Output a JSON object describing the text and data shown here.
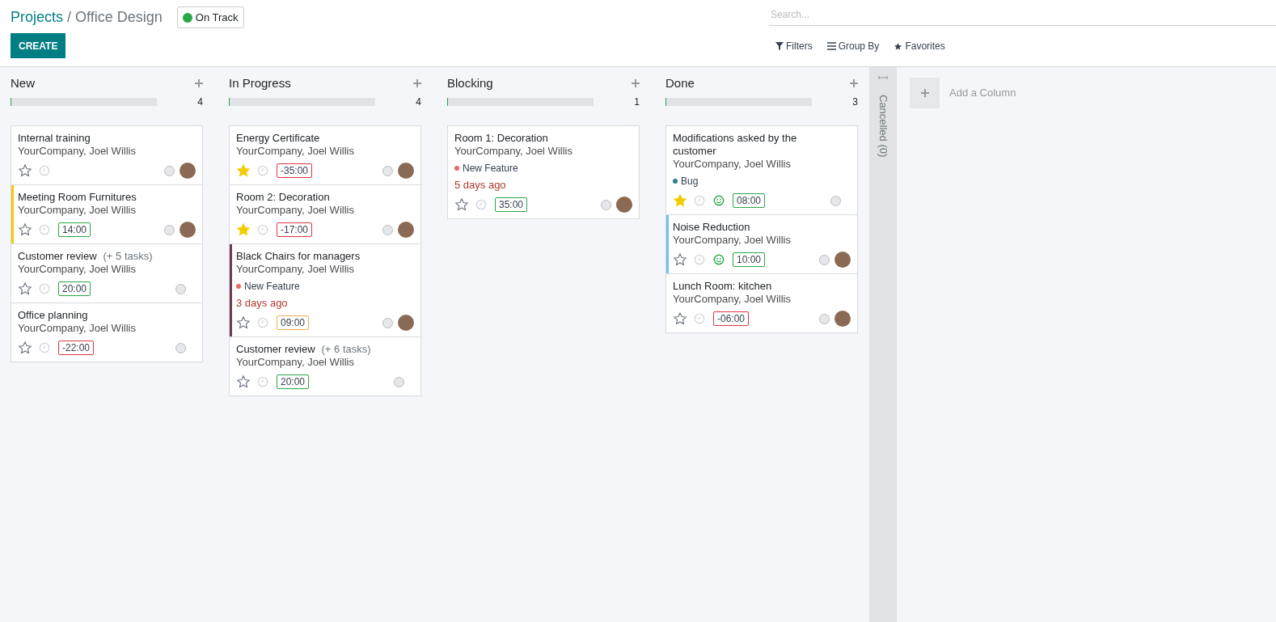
{
  "breadcrumb": {
    "parent": "Projects",
    "separator": "/",
    "current": "Office Design"
  },
  "status": {
    "label": "On Track",
    "color": "#28a745"
  },
  "create_button": "CREATE",
  "search": {
    "placeholder": "Search..."
  },
  "search_options": [
    {
      "kind": "filter",
      "label": "Filters"
    },
    {
      "kind": "group",
      "label": "Group By"
    },
    {
      "kind": "favorite",
      "label": "Favorites"
    }
  ],
  "columns": [
    {
      "title": "New",
      "count": "4",
      "level": 0,
      "cards": [
        {
          "title": "Internal training",
          "company": "YourCompany, Joel Willis",
          "starred": false,
          "avatar": true
        },
        {
          "title": "Meeting Room Furnitures",
          "company": "YourCompany, Joel Willis",
          "starred": false,
          "avatar": true,
          "color": "#f3cc00",
          "hours": {
            "text": "14:00",
            "color": "#28a745"
          }
        },
        {
          "title": "Customer review",
          "subtasks": "(+ 5 tasks)",
          "company": "YourCompany, Joel Willis",
          "starred": false,
          "avatar": false,
          "hours": {
            "text": "20:00",
            "color": "#28a745"
          }
        },
        {
          "title": "Office planning",
          "company": "YourCompany, Joel Willis",
          "starred": false,
          "avatar": false,
          "hours": {
            "text": "-22:00",
            "color": "#dc3545"
          }
        }
      ]
    },
    {
      "title": "In Progress",
      "count": "4",
      "level": 0,
      "cards": [
        {
          "title": "Energy Certificate",
          "company": "YourCompany, Joel Willis",
          "starred": true,
          "avatar": true,
          "hours": {
            "text": "-35:00",
            "color": "#dc3545"
          }
        },
        {
          "title": "Room 2: Decoration",
          "company": "YourCompany, Joel Willis",
          "starred": true,
          "avatar": true,
          "hours": {
            "text": "-17:00",
            "color": "#dc3545"
          }
        },
        {
          "title": "Black Chairs for managers",
          "company": "YourCompany, Joel Willis",
          "tag": {
            "label": "New Feature",
            "color": "#e76b5e"
          },
          "deadline": "3 days ago",
          "starred": false,
          "avatar": true,
          "color": "#6f3b50",
          "hours": {
            "text": "09:00",
            "color": "#f0ad4e"
          }
        },
        {
          "title": "Customer review",
          "subtasks": "(+ 6 tasks)",
          "company": "YourCompany, Joel Willis",
          "starred": false,
          "avatar": false,
          "hours": {
            "text": "20:00",
            "color": "#28a745"
          }
        }
      ]
    },
    {
      "title": "Blocking",
      "count": "1",
      "level": 0,
      "cards": [
        {
          "title": "Room 1: Decoration",
          "company": "YourCompany, Joel Willis",
          "tag": {
            "label": "New Feature",
            "color": "#e76b5e"
          },
          "deadline": "5 days ago",
          "starred": false,
          "avatar": true,
          "hours": {
            "text": "35:00",
            "color": "#28a745"
          }
        }
      ]
    },
    {
      "title": "Done",
      "count": "3",
      "level": 0,
      "cards": [
        {
          "title": "Modifications asked by the customer",
          "company": "YourCompany, Joel Willis",
          "tag": {
            "label": "Bug",
            "color": "#2e7d98"
          },
          "starred": true,
          "rated": true,
          "avatar": false,
          "hours": {
            "text": "08:00",
            "color": "#28a745"
          }
        },
        {
          "title": "Noise Reduction",
          "company": "YourCompany, Joel Willis",
          "starred": false,
          "rated": true,
          "avatar": true,
          "color": "#6cc1ed",
          "hours": {
            "text": "10:00",
            "color": "#28a745"
          }
        },
        {
          "title": "Lunch Room: kitchen",
          "company": "YourCompany, Joel Willis",
          "starred": false,
          "avatar": true,
          "hours": {
            "text": "-06:00",
            "color": "#dc3545"
          }
        }
      ]
    }
  ],
  "folded_column": "Cancelled (0)",
  "add_column": "Add a Column"
}
